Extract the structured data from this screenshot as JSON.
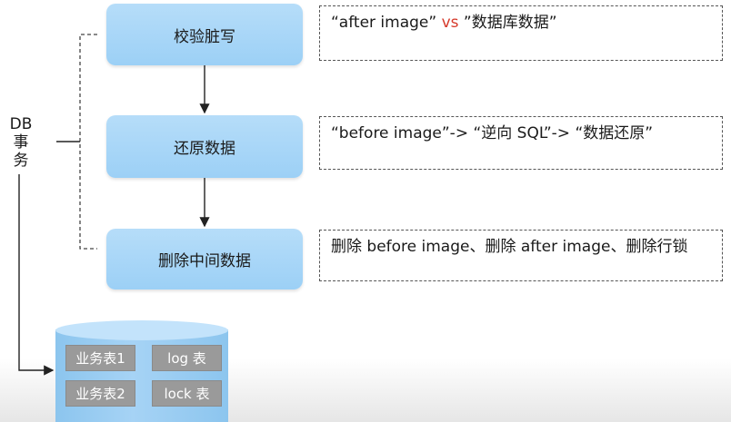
{
  "steps": [
    {
      "label": "校验脏写"
    },
    {
      "label": "还原数据"
    },
    {
      "label": "删除中间数据"
    }
  ],
  "notes": {
    "n1": {
      "left": "“after  image” ",
      "vs": "vs",
      "right": " ”数据库数据”"
    },
    "n2": {
      "text": "“before image”-> “逆向 SQL”-> “数据还原”"
    },
    "n3": {
      "text": "删除 before image、删除 after image、删除行锁"
    }
  },
  "db_label": "DB\n事\n务",
  "db_tables": [
    "业务表1",
    "log 表",
    "业务表2",
    "lock 表"
  ],
  "colors": {
    "step_fill": "#9cd0f6",
    "vs_red": "#d63a2b",
    "table_chip": "#9a9a9a"
  }
}
